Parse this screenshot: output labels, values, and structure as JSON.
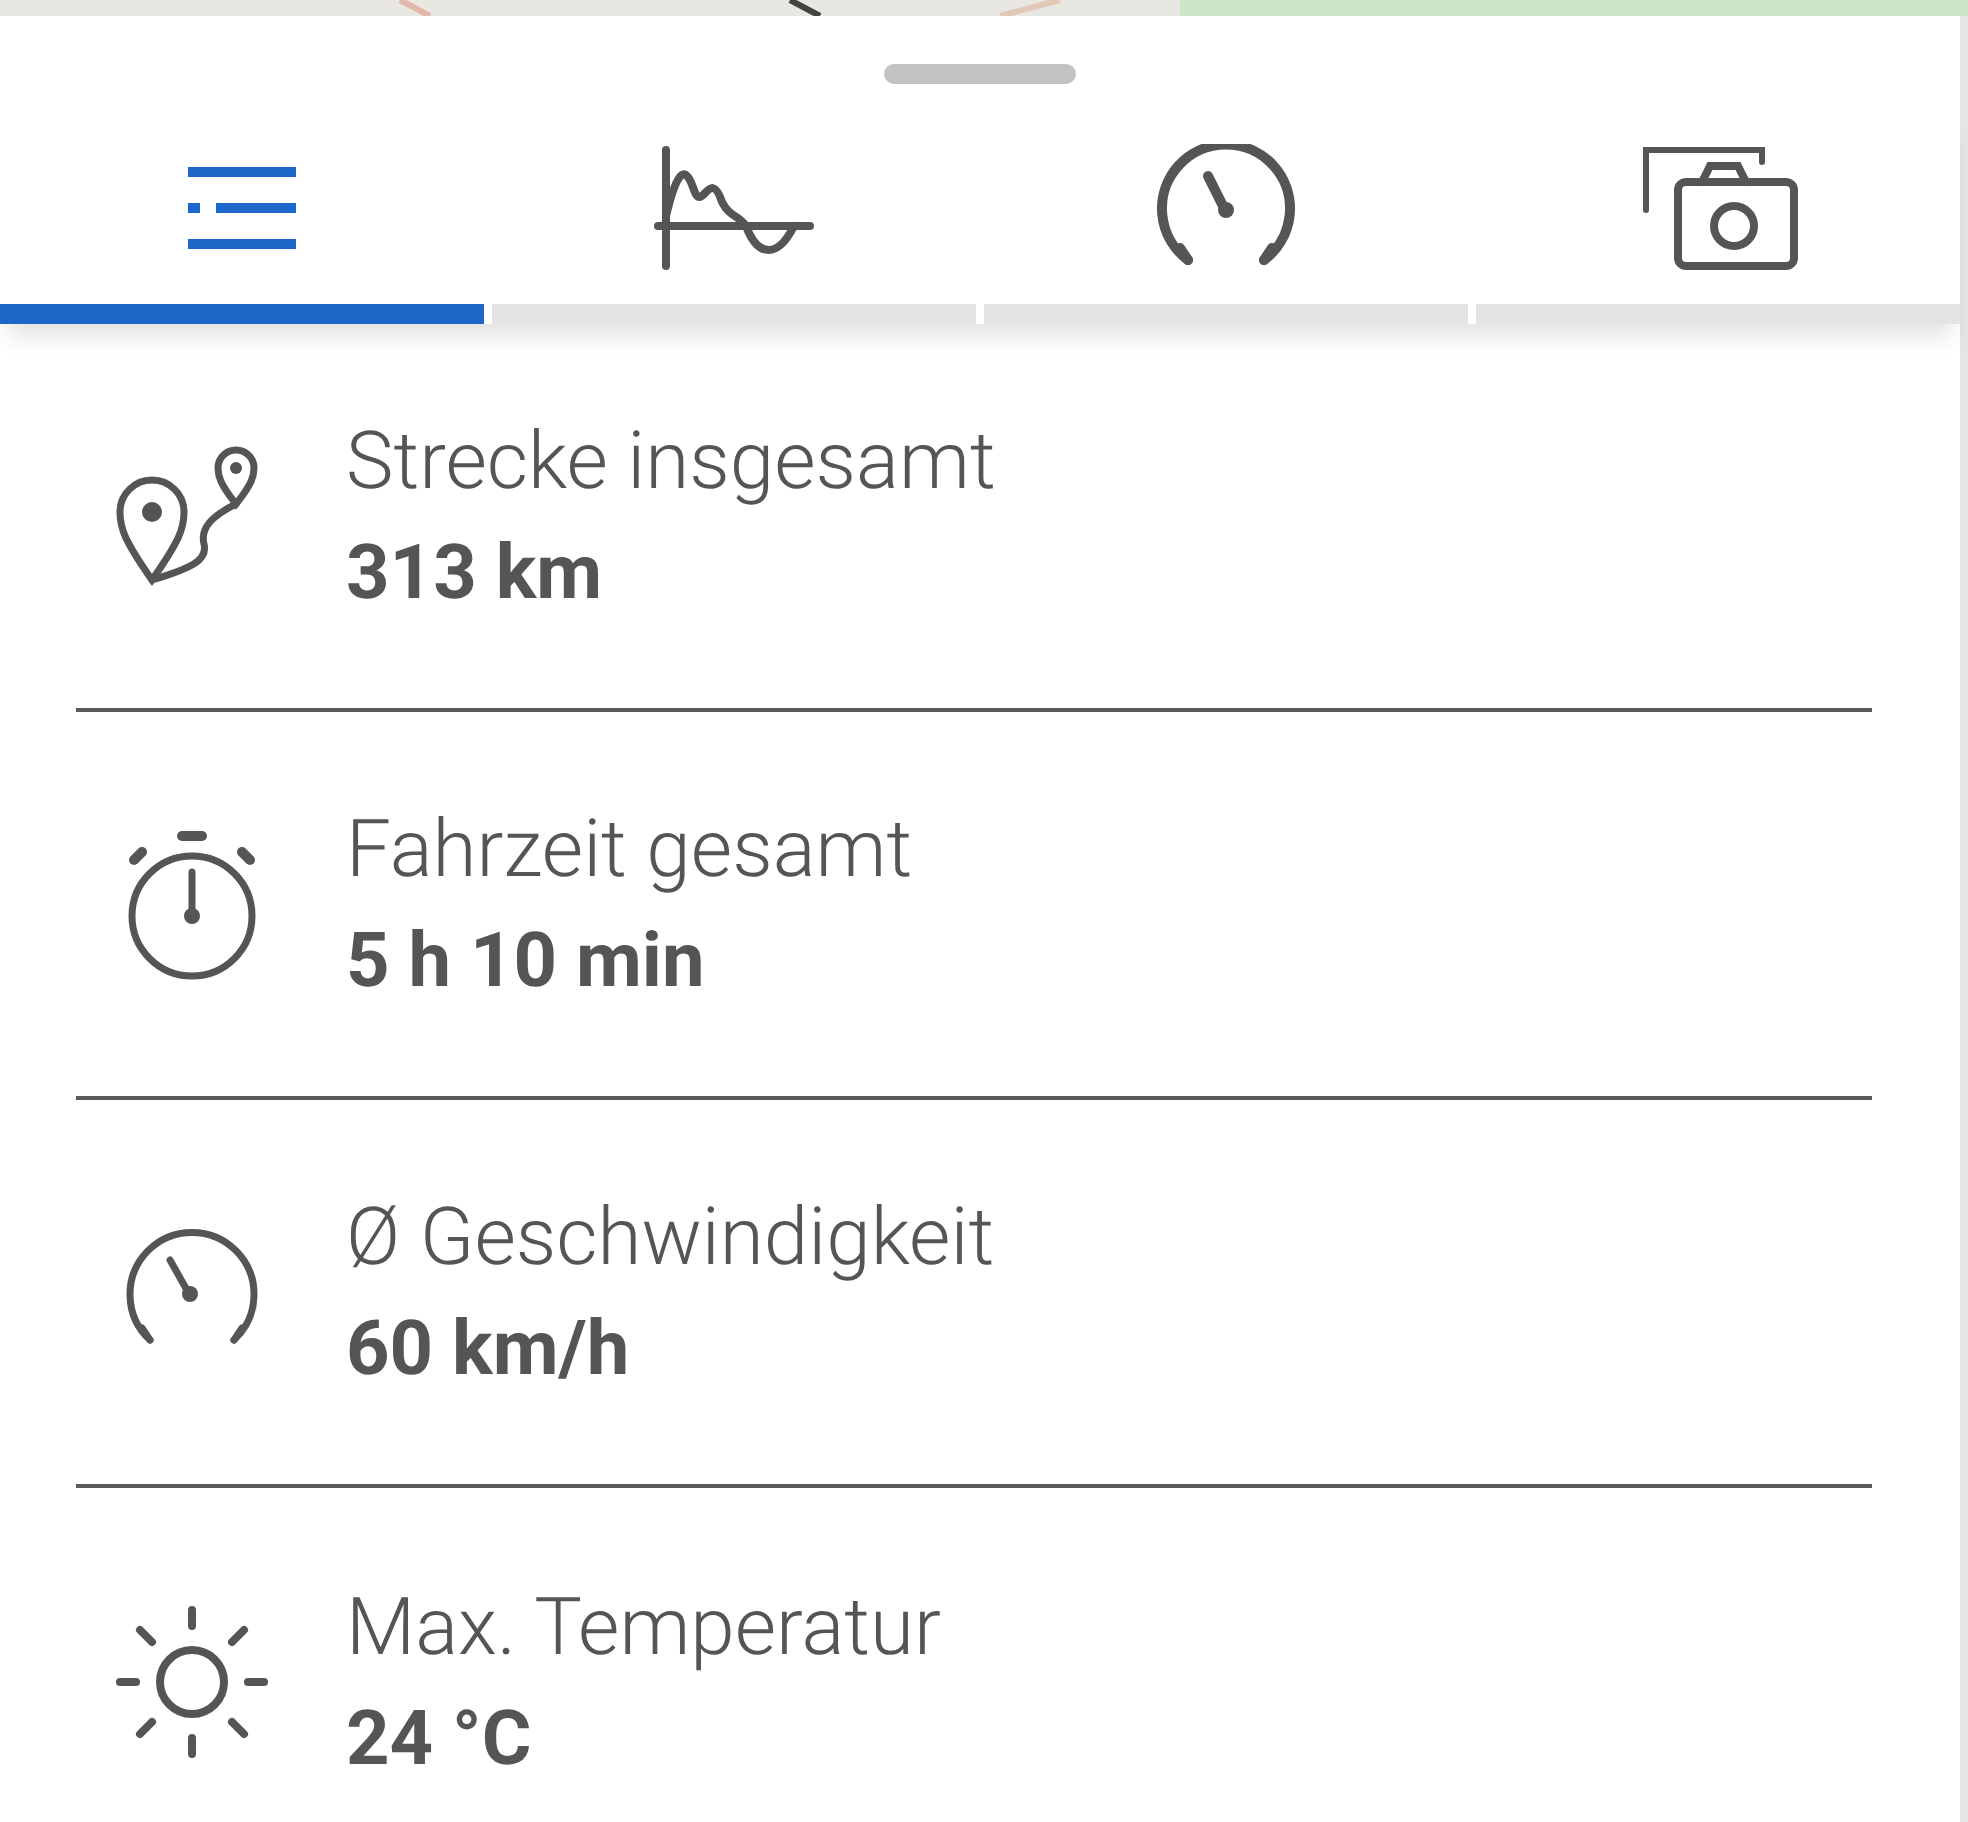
{
  "tabs": [
    {
      "selected": true
    },
    {
      "selected": false
    },
    {
      "selected": false
    },
    {
      "selected": false
    }
  ],
  "stats": [
    {
      "label": "Strecke insgesamt",
      "value": "313 km"
    },
    {
      "label": "Fahrzeit gesamt",
      "value": "5 h 10 min"
    },
    {
      "label": "Ø Geschwindigkeit",
      "value": "60 km/h"
    },
    {
      "label": "Max. Temperatur",
      "value": "24 °C"
    }
  ]
}
